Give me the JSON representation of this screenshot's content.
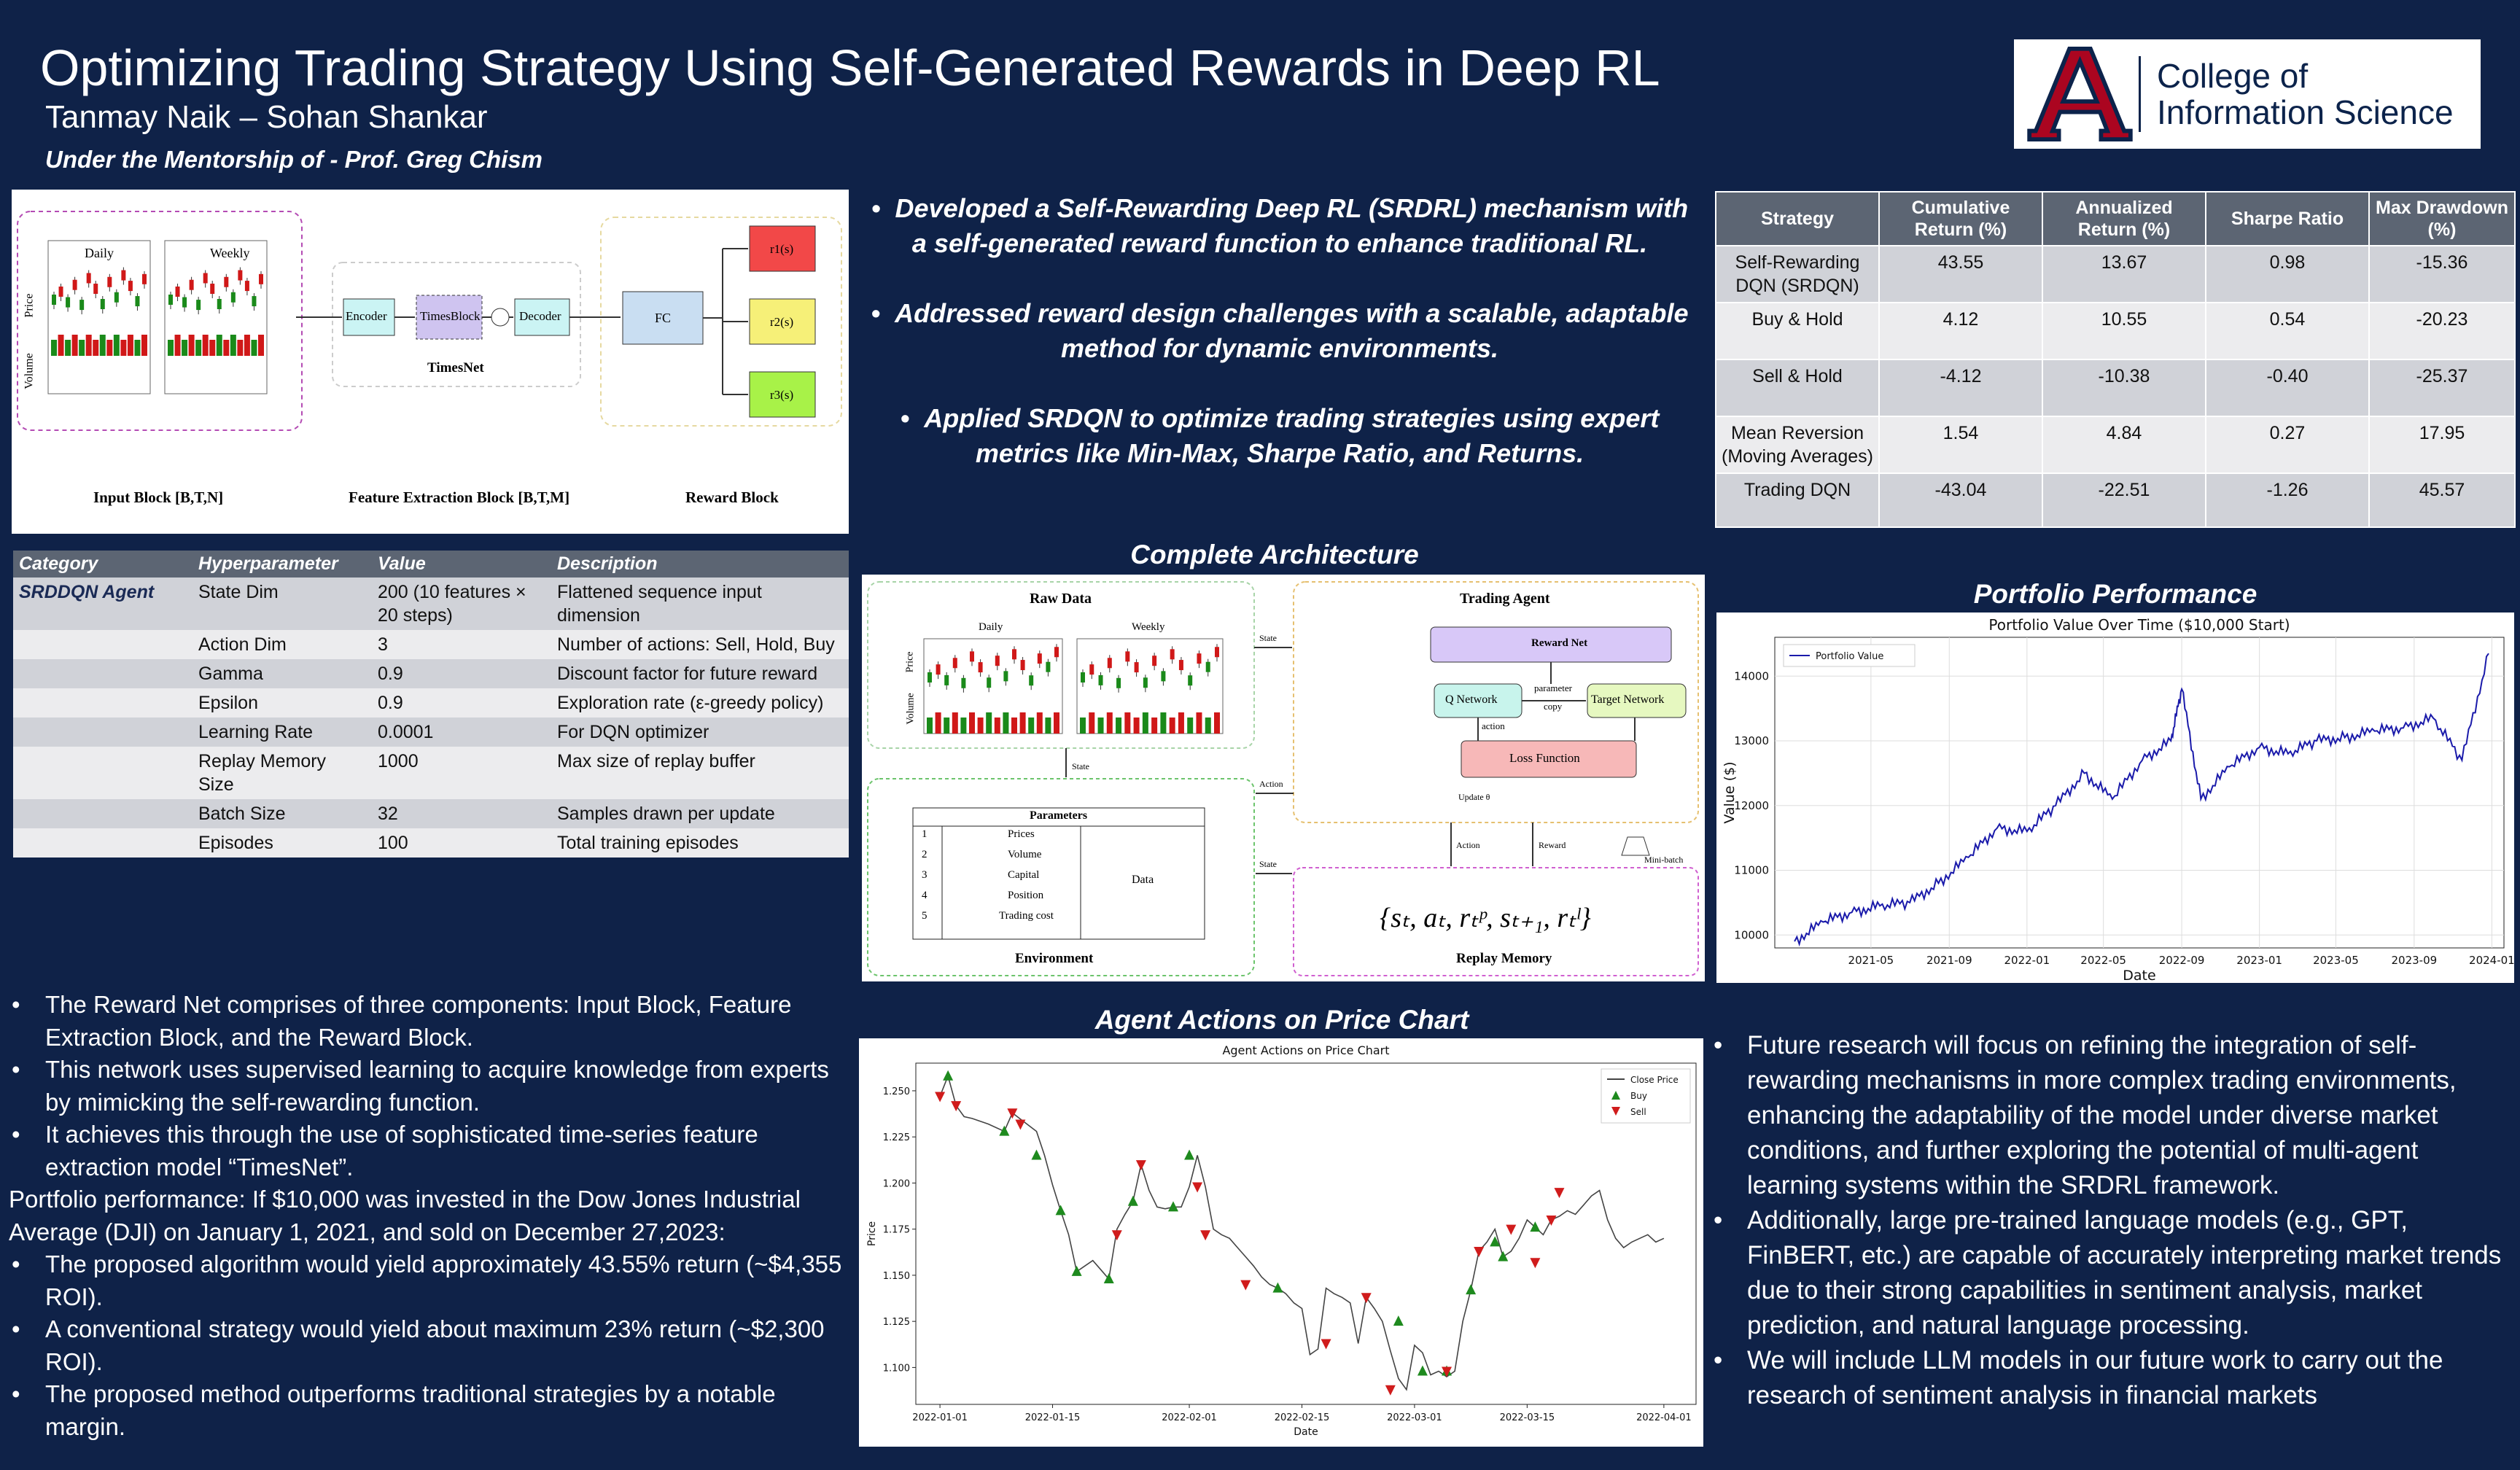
{
  "header": {
    "title": "Optimizing Trading Strategy Using Self-Generated Rewards in Deep RL",
    "authors": "Tanmay Naik – Sohan Shankar",
    "mentor": "Under the Mentorship of - Prof. Greg Chism",
    "logo_line1": "College of",
    "logo_line2": "Information Science"
  },
  "fig1": {
    "daily": "Daily",
    "weekly": "Weekly",
    "price": "Price",
    "volume": "Volume",
    "encoder": "Encoder",
    "timesblock": "TimesBlock",
    "decoder": "Decoder",
    "timesnet": "TimesNet",
    "fc": "FC",
    "r1": "r1(s)",
    "r2": "r2(s)",
    "r3": "r3(s)",
    "input_block": "Input Block [B,T,N]",
    "feature_block": "Feature Extraction Block [B,T,M]",
    "reward_block": "Reward Block"
  },
  "top_bullets": [
    "Developed a Self-Rewarding Deep RL (SRDRL) mechanism with a self-generated reward function to enhance traditional RL.",
    "Addressed reward design challenges with a scalable, adaptable method for dynamic environments.",
    "Applied SRDQN to optimize trading strategies using expert metrics like Min-Max, Sharpe Ratio, and Returns."
  ],
  "arch": {
    "title": "Complete Architecture",
    "raw_data": "Raw Data",
    "daily": "Daily",
    "weekly": "Weekly",
    "price": "Price",
    "volume": "Volume",
    "trading_agent": "Trading Agent",
    "reward_net": "Reward Net",
    "q_network": "Q Network",
    "target_network": "Target Network",
    "parameter_copy_1": "parameter",
    "parameter_copy_2": "copy",
    "action": "action",
    "loss_function": "Loss Function",
    "update": "Update θ",
    "state": "State",
    "action_label": "Action",
    "reward_label": "Reward",
    "minibatch": "Mini-batch",
    "parameters": "Parameters",
    "param_rows": [
      [
        "1",
        "Prices"
      ],
      [
        "2",
        "Volume"
      ],
      [
        "3",
        "Capital"
      ],
      [
        "4",
        "Position"
      ],
      [
        "5",
        "Trading cost"
      ]
    ],
    "data": "Data",
    "environment": "Environment",
    "tuple": "{sₜ, aₜ, rₜᵖ, sₜ₊₁, rₜˡ}",
    "replay_memory": "Replay Memory"
  },
  "hyperparams": {
    "headers": [
      "Category",
      "Hyperparameter",
      "Value",
      "Description"
    ],
    "rows": [
      [
        "SRDDQN Agent",
        "State Dim",
        "200 (10 features × 20 steps)",
        "Flattened sequence input dimension"
      ],
      [
        "",
        "Action Dim",
        "3",
        "Number of actions: Sell, Hold, Buy"
      ],
      [
        "",
        "Gamma",
        "0.9",
        "Discount factor for future reward"
      ],
      [
        "",
        "Epsilon",
        "0.9",
        "Exploration rate (ε-greedy policy)"
      ],
      [
        "",
        "Learning Rate",
        "0.0001",
        "For DQN optimizer"
      ],
      [
        "",
        "Replay Memory Size",
        "1000",
        "Max size of replay buffer"
      ],
      [
        "",
        "Batch Size",
        "32",
        "Samples drawn per update"
      ],
      [
        "",
        "Episodes",
        "100",
        "Total training episodes"
      ]
    ]
  },
  "results": {
    "headers": [
      "Strategy",
      "Cumulative Return (%)",
      "Annualized Return (%)",
      "Sharpe Ratio",
      "Max Drawdown (%)"
    ],
    "rows": [
      [
        "Self-Rewarding DQN (SRDQN)",
        "43.55",
        "13.67",
        "0.98",
        "-15.36"
      ],
      [
        "Buy & Hold",
        "4.12",
        "10.55",
        "0.54",
        "-20.23"
      ],
      [
        "Sell & Hold",
        "-4.12",
        "-10.38",
        "-0.40",
        "-25.37"
      ],
      [
        "Mean Reversion (Moving Averages)",
        "1.54",
        "4.84",
        "0.27",
        "17.95"
      ],
      [
        "Trading DQN",
        "-43.04",
        "-22.51",
        "-1.26",
        "45.57"
      ]
    ]
  },
  "portfolio": {
    "section_title": "Portfolio Performance",
    "chart_data": {
      "type": "line",
      "title": "Portfolio Value Over Time ($10,000 Start)",
      "xlabel": "Date",
      "ylabel": "Value ($)",
      "series": [
        {
          "name": "Portfolio Value",
          "x": [
            "2021-01-01",
            "2021-02-15",
            "2021-04-01",
            "2021-05-15",
            "2021-07-01",
            "2021-08-15",
            "2021-10-01",
            "2021-11-15",
            "2022-01-01",
            "2022-02-15",
            "2022-04-01",
            "2022-05-15",
            "2022-07-01",
            "2022-08-15",
            "2022-09-01",
            "2022-10-01",
            "2022-11-15",
            "2023-01-01",
            "2023-02-15",
            "2023-04-01",
            "2023-05-15",
            "2023-07-01",
            "2023-08-15",
            "2023-10-01",
            "2023-11-15",
            "2023-12-27"
          ],
          "values": [
            9900,
            10200,
            10350,
            10450,
            10500,
            10800,
            11200,
            11650,
            11600,
            12000,
            12500,
            12100,
            12700,
            13000,
            13800,
            12100,
            12600,
            12900,
            12800,
            13000,
            13050,
            13150,
            13200,
            13350,
            12700,
            14350
          ]
        }
      ],
      "x_ticks": [
        "2021-05",
        "2021-09",
        "2022-01",
        "2022-05",
        "2022-09",
        "2023-01",
        "2023-05",
        "2023-09",
        "2024-01"
      ],
      "y_ticks": [
        "10000",
        "11000",
        "12000",
        "13000",
        "14000"
      ],
      "ylim": [
        9800,
        14600
      ],
      "grid": true,
      "legend": "top-left"
    }
  },
  "actions": {
    "section_title": "Agent Actions on Price Chart",
    "chart_data": {
      "type": "line",
      "title": "Agent Actions on Price Chart",
      "xlabel": "Date",
      "ylabel": "Price",
      "ylim": [
        1.08,
        1.265
      ],
      "x_ticks": [
        "2022-01-01",
        "2022-01-15",
        "2022-02-01",
        "2022-02-15",
        "2022-03-01",
        "2022-03-15",
        "2022-04-01"
      ],
      "y_ticks": [
        "1.100",
        "1.125",
        "1.150",
        "1.175",
        "1.200",
        "1.225",
        "1.250"
      ],
      "legend": "top-right",
      "series": [
        {
          "name": "Close Price",
          "x": [
            0,
            1,
            2,
            3,
            4,
            6,
            8,
            9,
            12,
            13,
            14,
            15,
            16,
            17,
            18,
            19,
            20,
            21,
            22,
            23,
            24,
            25,
            26,
            27,
            28,
            29,
            30,
            31,
            32,
            33,
            34,
            35,
            36,
            37,
            38,
            39,
            40,
            41,
            42,
            43,
            44,
            45,
            46,
            47,
            48,
            49,
            50,
            51,
            52,
            53,
            54,
            55,
            56,
            57,
            58,
            59,
            60,
            61,
            62,
            63,
            64,
            65,
            66,
            67,
            68,
            69,
            70,
            71,
            72,
            73,
            74,
            75,
            76,
            77,
            78,
            79,
            80,
            81,
            82,
            83,
            84,
            85,
            86,
            87,
            88,
            89,
            90
          ],
          "values": [
            1.247,
            1.258,
            1.242,
            1.236,
            1.235,
            1.232,
            1.228,
            1.238,
            1.228,
            1.215,
            1.199,
            1.185,
            1.172,
            1.152,
            1.155,
            1.158,
            1.153,
            1.148,
            1.175,
            1.183,
            1.19,
            1.21,
            1.196,
            1.187,
            1.186,
            1.187,
            1.187,
            1.198,
            1.215,
            1.198,
            1.175,
            1.172,
            1.17,
            1.165,
            1.16,
            1.155,
            1.149,
            1.145,
            1.143,
            1.14,
            1.135,
            1.132,
            1.107,
            1.11,
            1.143,
            1.14,
            1.138,
            1.135,
            1.113,
            1.138,
            1.132,
            1.125,
            1.109,
            1.094,
            1.088,
            1.112,
            1.108,
            1.096,
            1.098,
            1.095,
            1.098,
            1.125,
            1.142,
            1.163,
            1.168,
            1.175,
            1.16,
            1.163,
            1.17,
            1.18,
            1.176,
            1.172,
            1.18,
            1.182,
            1.185,
            1.183,
            1.188,
            1.193,
            1.196,
            1.18,
            1.17,
            1.165,
            1.168,
            1.17,
            1.172,
            1.168,
            1.17
          ]
        },
        {
          "name": "Buy",
          "x": [
            1,
            8,
            12,
            15,
            17,
            21,
            24,
            29,
            31,
            42,
            57,
            60,
            63,
            66,
            69,
            70,
            74
          ],
          "values": [
            1.258,
            1.228,
            1.215,
            1.185,
            1.152,
            1.148,
            1.19,
            1.187,
            1.215,
            1.143,
            1.125,
            1.098,
            1.098,
            1.142,
            1.168,
            1.16,
            1.176
          ]
        },
        {
          "name": "Sell",
          "x": [
            0,
            2,
            9,
            10,
            22,
            25,
            32,
            33,
            38,
            48,
            53,
            56,
            63,
            67,
            71,
            74,
            76,
            77
          ],
          "values": [
            1.247,
            1.242,
            1.238,
            1.232,
            1.172,
            1.21,
            1.198,
            1.172,
            1.145,
            1.113,
            1.138,
            1.088,
            1.098,
            1.163,
            1.175,
            1.157,
            1.18,
            1.195
          ]
        }
      ]
    }
  },
  "bottom_left": {
    "bullets_a": [
      "The Reward Net comprises of three components: Input Block, Feature Extraction Block, and the Reward Block.",
      "This network uses supervised learning to acquire knowledge from experts by mimicking the self-rewarding function.",
      "It achieves this through the use of sophisticated time-series feature extraction model “TimesNet”."
    ],
    "paragraph": "Portfolio performance: If $10,000 was invested in the Dow Jones Industrial Average (DJI) on January 1, 2021, and sold on December 27,2023:",
    "bullets_b": [
      "The proposed algorithm would yield approximately 43.55% return (~$4,355 ROI).",
      "A conventional strategy would yield about maximum 23% return (~$2,300 ROI).",
      "The proposed method outperforms traditional strategies by a notable margin."
    ]
  },
  "bottom_right": {
    "bullets": [
      "Future research will focus on refining the integration of self-rewarding mechanisms in more complex trading environments, enhancing the adaptability of the model under diverse market conditions, and further exploring the potential of multi-agent learning systems within the SRDRL framework.",
      "Additionally, large pre-trained language models (e.g., GPT, FinBERT, etc.) are capable of accurately interpreting market trends due to their strong capabilities in sentiment analysis, market prediction, and natural language processing.",
      "We will include LLM models in our future work to carry out the research of sentiment analysis in financial markets"
    ]
  }
}
